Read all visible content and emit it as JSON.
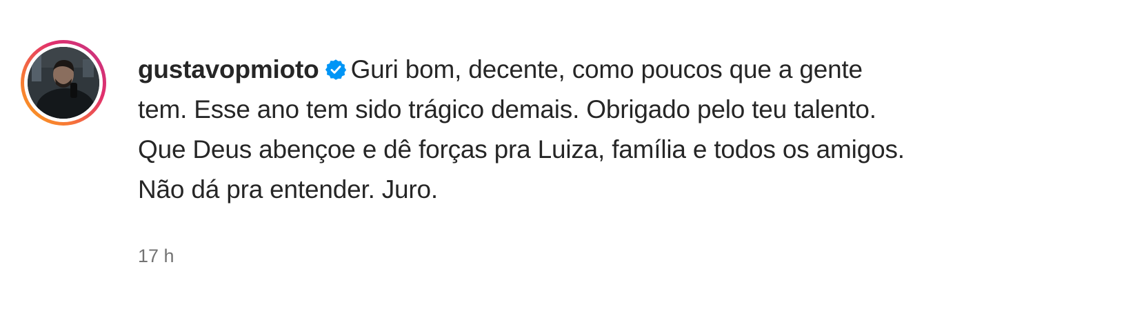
{
  "comment": {
    "username": "gustavopmioto",
    "verified_icon": "verified-badge-icon",
    "avatar_icon": "profile-photo",
    "ring_colors": [
      "#f9a21a",
      "#f77737",
      "#e1306c",
      "#c13584"
    ],
    "badge_color": "#0095f6",
    "text_lines": [
      "Guri bom, decente, como poucos que a gente",
      "tem. Esse ano tem sido trágico demais. Obrigado pelo teu talento.",
      "Que Deus abençoe e dê forças pra Luiza, família e todos os amigos.",
      "Não dá pra entender. Juro."
    ],
    "timestamp": "17 h"
  }
}
